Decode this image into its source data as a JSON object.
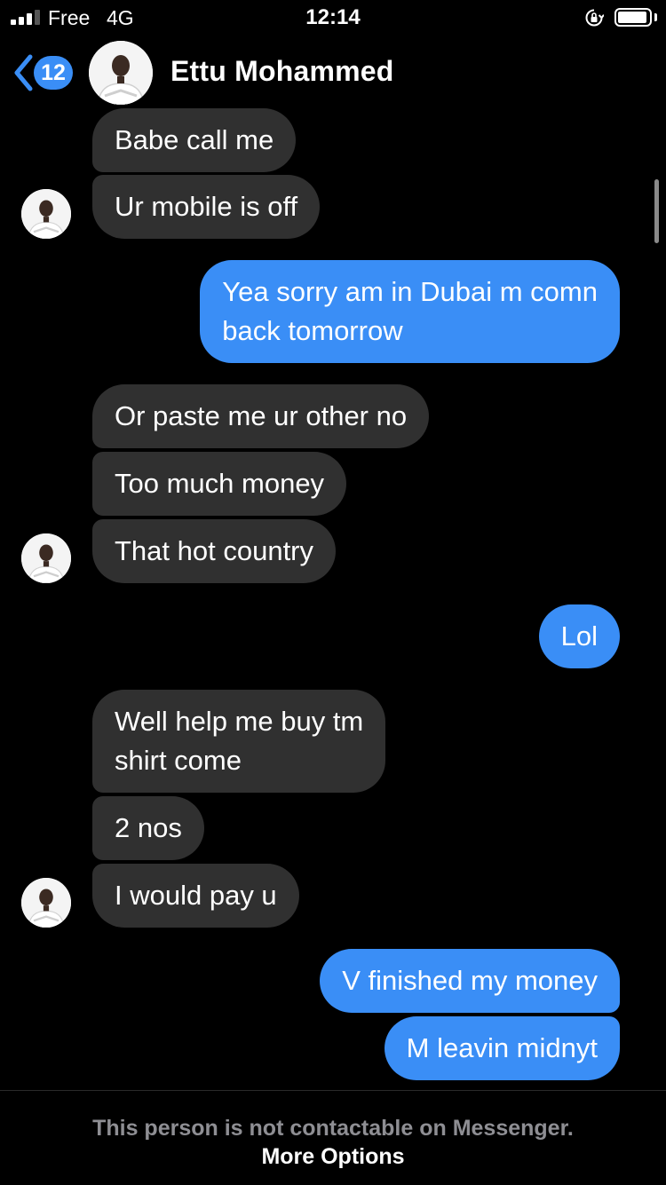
{
  "status_bar": {
    "carrier": "Free",
    "network": "4G",
    "time": "12:14",
    "signal_bars_active": 3,
    "signal_bars_total": 4,
    "battery_level": 0.95
  },
  "header": {
    "unread_count": "12",
    "contact_name": "Ettu Mohammed",
    "accent_color": "#3a8ef6"
  },
  "messages": [
    {
      "direction": "in",
      "text": "Babe call me"
    },
    {
      "direction": "in",
      "text": "Ur mobile is off"
    },
    {
      "direction": "out",
      "text": "Yea sorry am in Dubai m comn\nback tomorrow"
    },
    {
      "direction": "in",
      "text": "Or paste me ur other no"
    },
    {
      "direction": "in",
      "text": "Too much money"
    },
    {
      "direction": "in",
      "text": "That hot country"
    },
    {
      "direction": "out",
      "text": "Lol"
    },
    {
      "direction": "in",
      "text": "Well help me buy tm\nshirt come"
    },
    {
      "direction": "in",
      "text": "2 nos"
    },
    {
      "direction": "in",
      "text": "I would pay u"
    },
    {
      "direction": "out",
      "text": "V finished my money"
    },
    {
      "direction": "out",
      "text": "M leavin midnyt"
    }
  ],
  "footer": {
    "notice": "This person is not contactable on Messenger.",
    "more_options": "More Options"
  },
  "colors": {
    "incoming_bubble": "#303030",
    "outgoing_bubble": "#3a8ef6",
    "background": "#000000"
  }
}
